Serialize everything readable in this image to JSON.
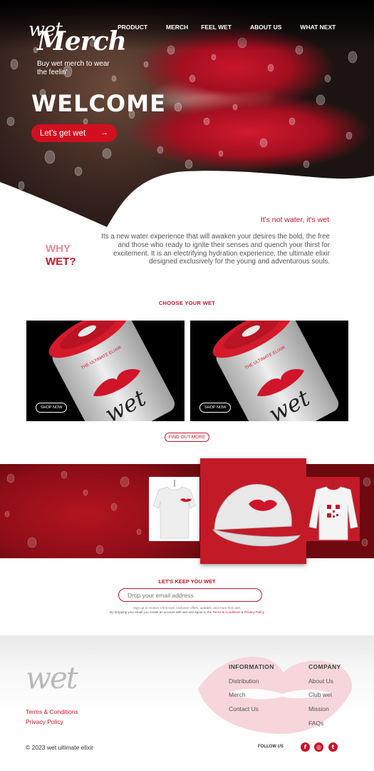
{
  "brand": {
    "logo": "wet",
    "accent": "#c8142a",
    "accent_light": "#e98ba0"
  },
  "nav": {
    "items": [
      "PRODUCT",
      "MERCH",
      "FEEL WET",
      "ABOUT US",
      "WHAT NEXT"
    ]
  },
  "hero": {
    "title": "WELCOME",
    "cta_label": "Let's get wet",
    "cta_icon": "arrow-right-icon"
  },
  "why": {
    "tagline": "It's not water, it's wet",
    "heading_line1": "WHY",
    "heading_line2": "WET?",
    "body": "Its a new water experience that will awaken your desires the bold, the free and those who ready to ignite their senses and quench your thirst for excitement. It is an electrifying hydration experience, the ultimate elixir designed exclusively for the young and adventurous souls."
  },
  "choose": {
    "title": "CHOOSE YOUR WET",
    "products": [
      {
        "shop_label": "SHOP NOW",
        "can_logo": "wet"
      },
      {
        "shop_label": "SHOP NOW",
        "can_logo": "wet"
      }
    ],
    "find_more_label": "FIND OUT MORE"
  },
  "merch": {
    "title": "Merch",
    "subtitle": "Buy wet merch to wear the feelin'"
  },
  "newsletter": {
    "title": "LET'S KEEP YOU WET",
    "email_placeholder": "Drop your email address",
    "fine_print_1": "Sign up to receive a first look, exclusive offers, updates, and more from wet.",
    "fine_print_2": "By dropping your email you create an account with wet and agree to the",
    "terms_link": "Terms & Conditions",
    "and_text": "&",
    "privacy_link": "Privacy Policy"
  },
  "footer": {
    "logo": "wet",
    "links": [
      "Terms & Conditions",
      "Privacy Policy"
    ],
    "information": {
      "title": "INFORMATION",
      "items": [
        "Distribution",
        "Merch",
        "Contact Us"
      ]
    },
    "company": {
      "title": "COMPANY",
      "items": [
        "About Us",
        "Club wet",
        "Mission",
        "FAQs"
      ]
    },
    "copyright": "© 2023 wet ultimate elixir",
    "follow_label": "FOLLOW US",
    "social": [
      "facebook-icon",
      "instagram-icon",
      "twitter-icon"
    ]
  }
}
